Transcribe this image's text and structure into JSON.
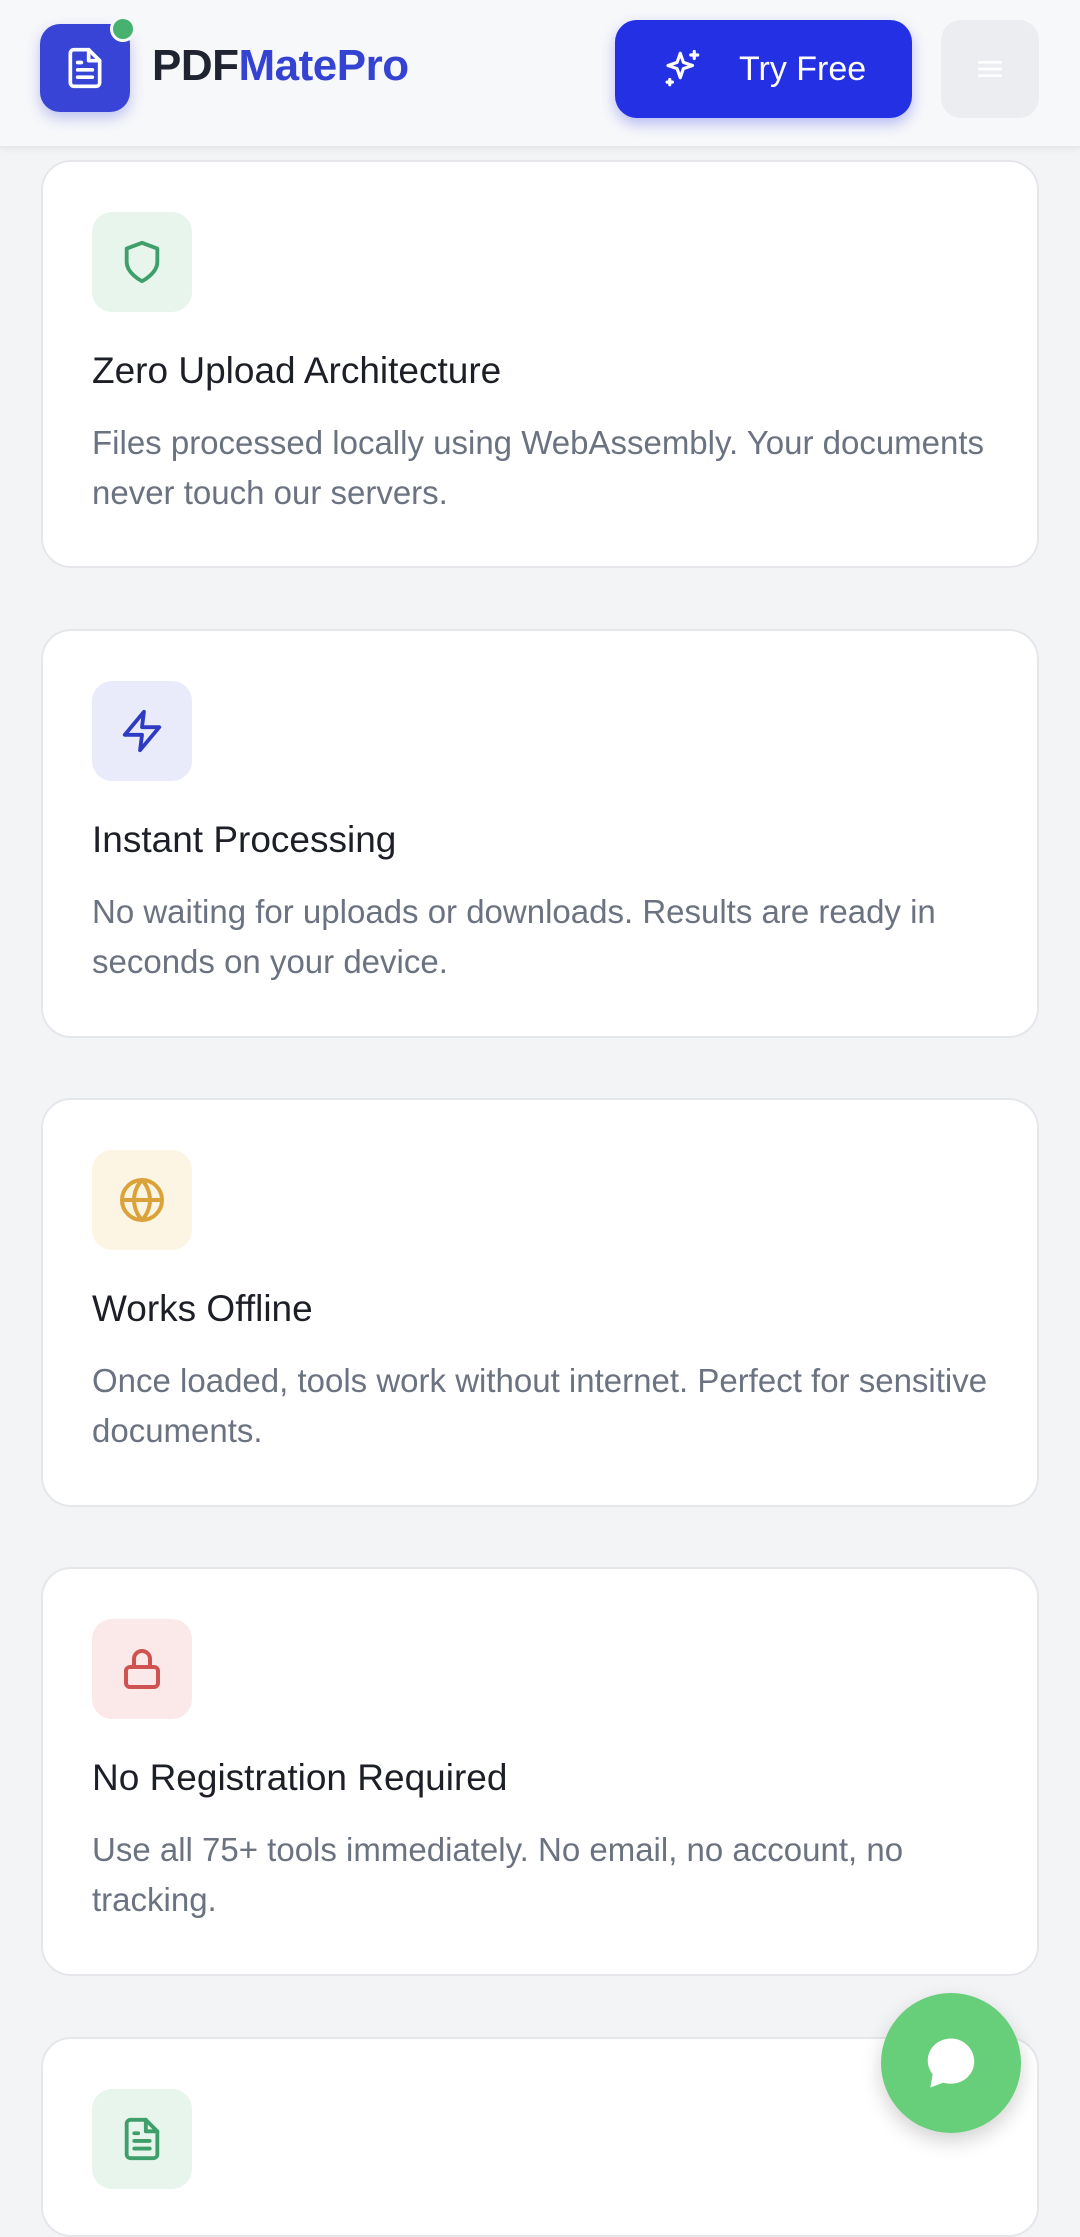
{
  "header": {
    "brand_part1": "PDF",
    "brand_part2": "MatePro",
    "cta_label": "Try Free",
    "logo_icon": "document-icon",
    "status_dot_color": "#47b16f",
    "accent": "#2430e3",
    "menu_icon": "hamburger-menu-icon"
  },
  "features": [
    {
      "icon": "shield-icon",
      "icon_color": "#3f9f6a",
      "tile_color": "#e7f5ec",
      "title": "Zero Upload Architecture",
      "description": "Files processed locally using WebAssembly. Your documents never touch our servers."
    },
    {
      "icon": "lightning-icon",
      "icon_color": "#2f3bc2",
      "tile_color": "#e9ebfb",
      "title": "Instant Processing",
      "description": "No waiting for uploads or downloads. Results are ready in seconds on your device."
    },
    {
      "icon": "globe-icon",
      "icon_color": "#dca23a",
      "tile_color": "#fdf5e3",
      "title": "Works Offline",
      "description": "Once loaded, tools work without internet. Perfect for sensitive documents."
    },
    {
      "icon": "lock-icon",
      "icon_color": "#d05353",
      "tile_color": "#fbe9e9",
      "title": "No Registration Required",
      "description": "Use all 75+ tools immediately. No email, no account, no tracking."
    },
    {
      "icon": "file-text-icon",
      "icon_color": "#3f9f6a",
      "tile_color": "#e7f5ec",
      "title": "",
      "description": ""
    }
  ],
  "chat": {
    "icon": "chat-bubble-icon",
    "color": "#67cf79"
  }
}
